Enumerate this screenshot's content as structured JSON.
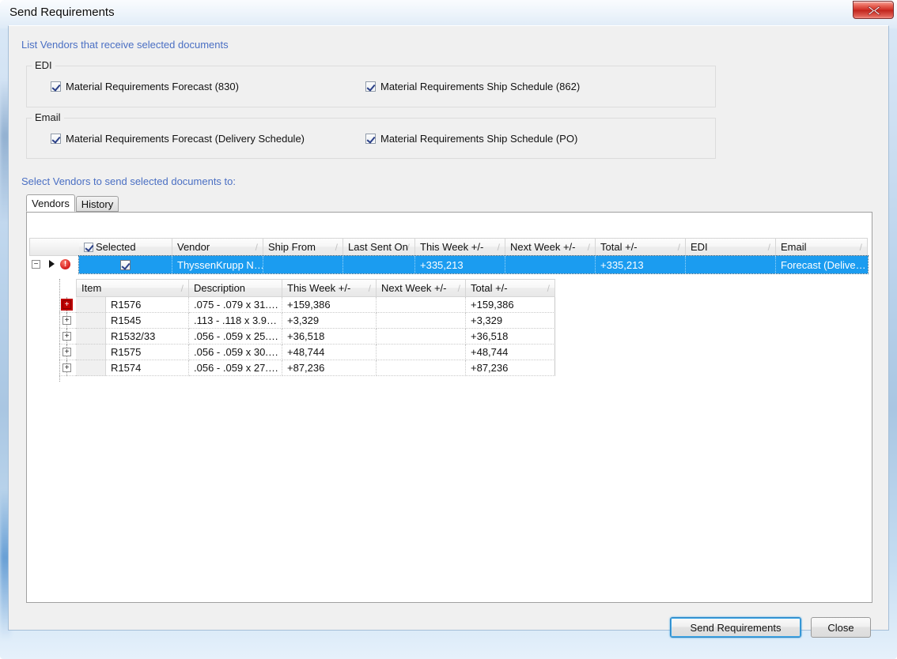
{
  "window": {
    "title": "Send Requirements",
    "close_glyph": "close-icon"
  },
  "headers": {
    "list_vendors": "List Vendors that receive selected documents",
    "select_vendors": "Select Vendors to send selected documents to:"
  },
  "groups": [
    {
      "legend": "EDI",
      "options": [
        {
          "label": "Material Requirements Forecast (830)",
          "checked": true
        },
        {
          "label": "Material Requirements Ship Schedule (862)",
          "checked": true
        }
      ]
    },
    {
      "legend": "Email",
      "options": [
        {
          "label": "Material Requirements Forecast (Delivery Schedule)",
          "checked": true
        },
        {
          "label": "Material Requirements Ship Schedule (PO)",
          "checked": true
        }
      ]
    }
  ],
  "tabs": [
    {
      "label": "Vendors",
      "active": true
    },
    {
      "label": "History",
      "active": false
    }
  ],
  "vendor_grid": {
    "columns": [
      "Selected",
      "Vendor",
      "Ship From",
      "Last Sent On",
      "This Week +/-",
      "Next Week +/-",
      "Total +/-",
      "EDI",
      "Email"
    ],
    "filter_glyph": "/",
    "row": {
      "selected": true,
      "vendor": "ThyssenKrupp  N…",
      "ship_from": "",
      "last_sent_on": "",
      "this_week": "+335,213",
      "next_week": "",
      "total": "+335,213",
      "edi": "",
      "email": "Forecast  (Delive…",
      "expander": "−",
      "has_error": true,
      "error_glyph": "!"
    }
  },
  "detail_grid": {
    "columns": [
      "Item",
      "Description",
      "This Week +/-",
      "Next Week +/-",
      "Total +/-"
    ],
    "filter_glyph": "/",
    "expander": "+",
    "rows": [
      {
        "item": "R1576",
        "description": ".075 -  .079 x 31.…",
        "this_week": "+159,386",
        "next_week": "",
        "total": "+159,386",
        "current": true
      },
      {
        "item": "R1545",
        "description": ".113 -  .118 x 3.9…",
        "this_week": "+3,329",
        "next_week": "",
        "total": "+3,329",
        "current": false
      },
      {
        "item": "R1532/33",
        "description": ".056 -  .059   x 25.…",
        "this_week": "+36,518",
        "next_week": "",
        "total": "+36,518",
        "current": false
      },
      {
        "item": "R1575",
        "description": ".056 -  .059 x 30.…",
        "this_week": "+48,744",
        "next_week": "",
        "total": "+48,744",
        "current": false
      },
      {
        "item": "R1574",
        "description": ".056 -  .059 x 27.…",
        "this_week": "+87,236",
        "next_week": "",
        "total": "+87,236",
        "current": false
      }
    ]
  },
  "footer": {
    "send_label": "Send Requirements",
    "close_label": "Close"
  },
  "colors": {
    "selection_blue": "#1b9cf0",
    "link_blue": "#4a6fc3",
    "error_red": "#c00000",
    "window_chrome": "#bcd4ec"
  }
}
